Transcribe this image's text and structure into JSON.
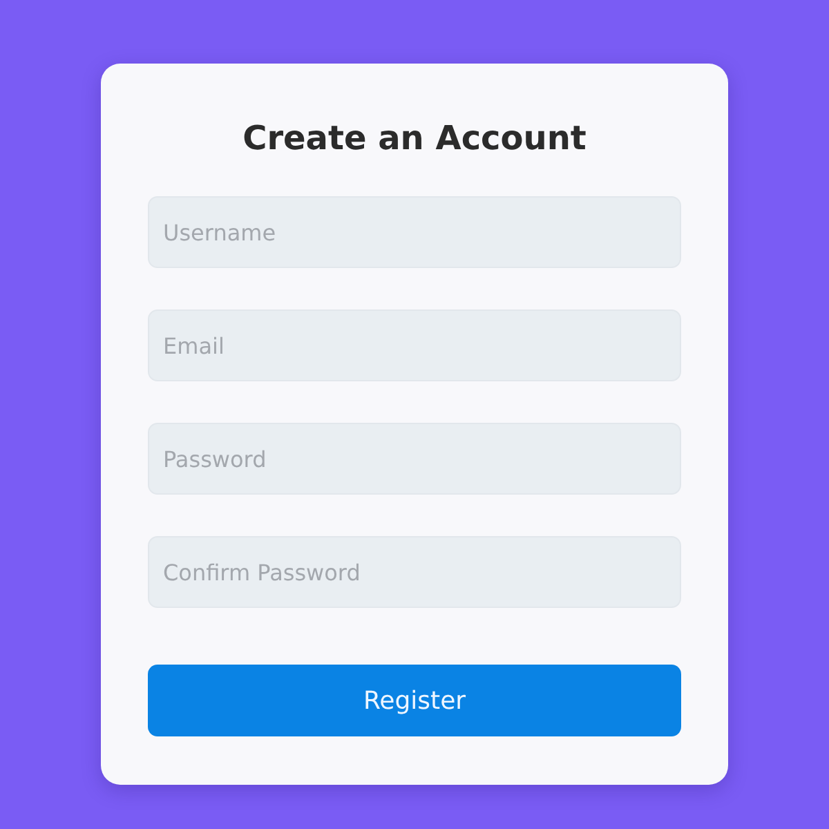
{
  "form": {
    "title": "Create an Account",
    "fields": [
      {
        "placeholder": "Username"
      },
      {
        "placeholder": "Email"
      },
      {
        "placeholder": "Password"
      },
      {
        "placeholder": "Confirm Password"
      }
    ],
    "submit": {
      "label": "Register"
    }
  }
}
